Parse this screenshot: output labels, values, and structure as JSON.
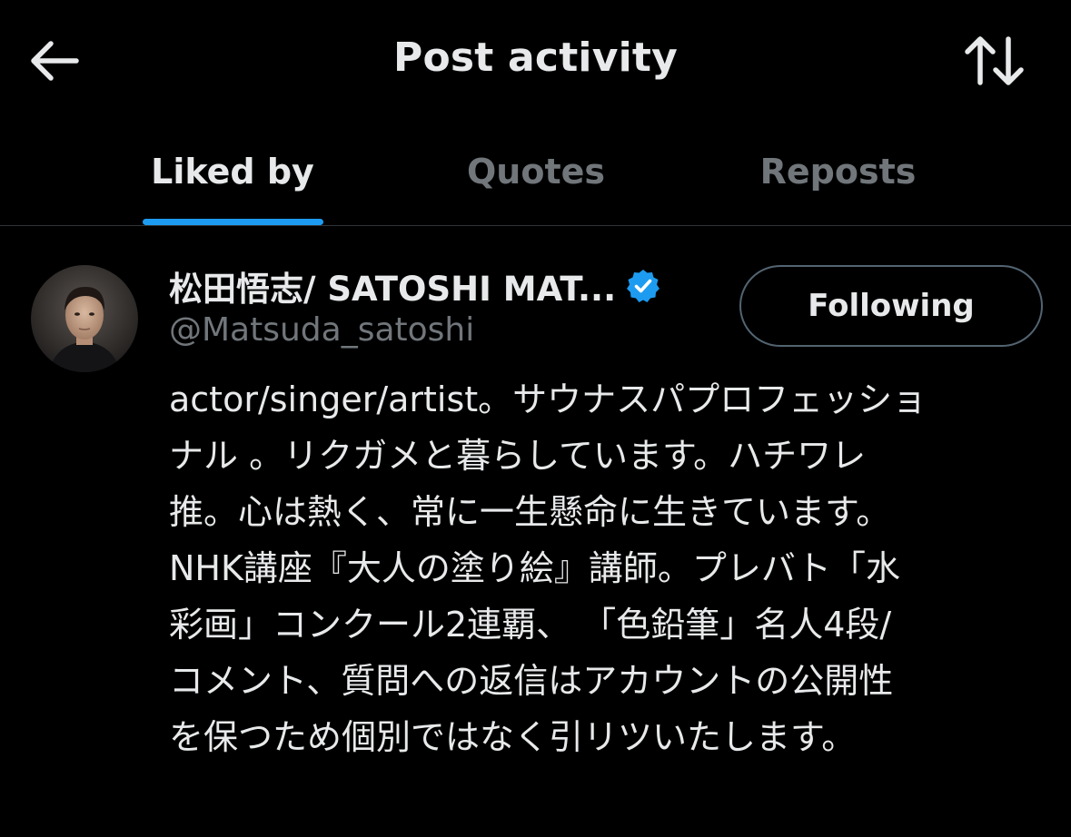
{
  "header": {
    "title": "Post activity",
    "back_icon": "arrow-left-icon",
    "sort_icon": "sort-arrows-icon"
  },
  "tabs": [
    {
      "label": "Liked by",
      "active": true
    },
    {
      "label": "Quotes",
      "active": false
    },
    {
      "label": "Reposts",
      "active": false
    }
  ],
  "user": {
    "display_name": "松田悟志/ SATOSHI MAT...",
    "handle": "@Matsuda_satoshi",
    "verified": true,
    "follow_label": "Following",
    "bio_lines": [
      "actor/singer/artist。サウナスパプロフェッショ",
      "ナル 。リクガメと暮らしています。ハチワレ",
      "推。心は熱く、常に一生懸命に生きています。",
      "NHK講座『大人の塗り絵』講師。プレバト「水",
      "彩画」コンクール2連覇、 「色鉛筆」名人4段/",
      "コメント、質問への返信はアカウントの公開性",
      "を保つため個別ではなく引リツいたします。"
    ]
  },
  "colors": {
    "background": "#000000",
    "text_primary": "#e7e9ea",
    "text_secondary": "#71767b",
    "accent": "#1d9bf0",
    "divider": "#2f3336",
    "button_border": "#536471"
  }
}
